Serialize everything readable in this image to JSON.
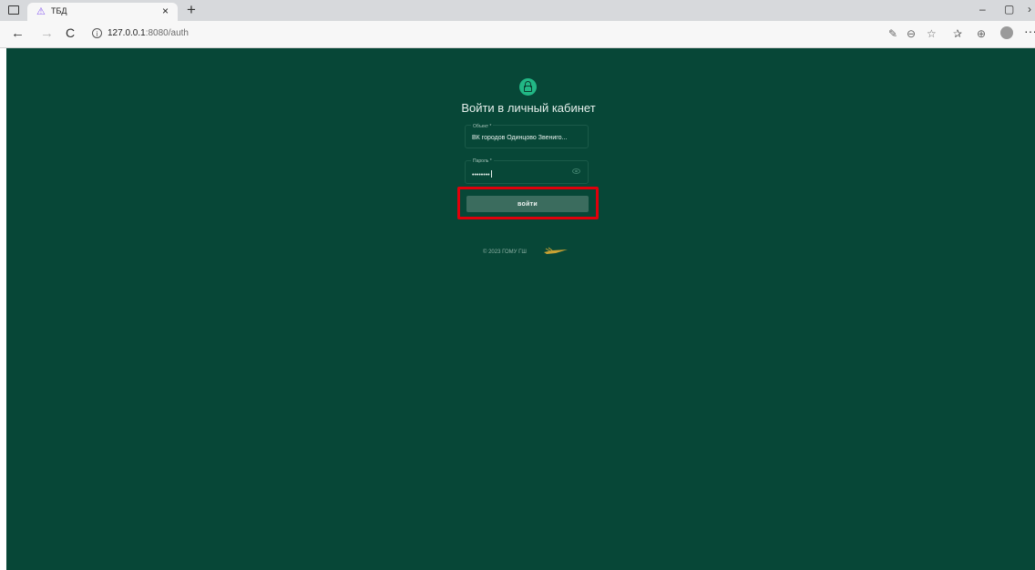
{
  "browser": {
    "tab_title": "ТБД",
    "tab_close": "×",
    "new_tab": "+",
    "url_host": "127.0.0.1",
    "url_path": ":8080/auth",
    "info_glyph": "i",
    "back_glyph": "←",
    "forward_glyph": "→",
    "reload_glyph": "C",
    "minimize_glyph": "–",
    "restore_glyph": "▢",
    "close_glyph": "›",
    "more_glyph": "···"
  },
  "login": {
    "heading": "Войти в личный кабинет",
    "object_label": "Объект *",
    "object_value": "ВК городов Одинцово Звениго...",
    "password_label": "Пароль *",
    "password_value": "••••••••",
    "submit_label": "войти",
    "footer_text": "© 2023 ГОМУ ГШ"
  },
  "colors": {
    "page_background": "#074737",
    "accent": "#22b785",
    "button": "#3b6c5e",
    "highlight": "#e0000b"
  },
  "icons": [
    "window-menu-icon",
    "tab-logo-icon",
    "lock-icon",
    "eye-icon",
    "emblem-logo"
  ]
}
